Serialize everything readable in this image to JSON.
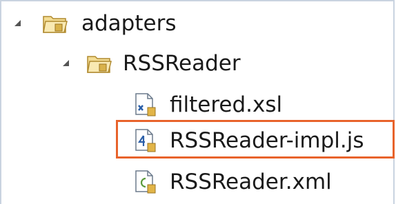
{
  "tree": {
    "nodes": [
      {
        "label": "adapters",
        "icon": "folder-icon",
        "expanded": true,
        "level": 0
      },
      {
        "label": "RSSReader",
        "icon": "folder-icon",
        "expanded": true,
        "level": 1
      },
      {
        "label": "filtered.xsl",
        "icon": "xsl-file-icon",
        "level": 2
      },
      {
        "label": "RSSReader-impl.js",
        "icon": "js-file-icon",
        "level": 2,
        "highlighted": true
      },
      {
        "label": "RSSReader.xml",
        "icon": "xml-file-icon",
        "level": 2
      }
    ]
  },
  "colors": {
    "highlight_border": "#e8632b",
    "folder": "#e9c46a",
    "frame": "#c9d3e0"
  }
}
